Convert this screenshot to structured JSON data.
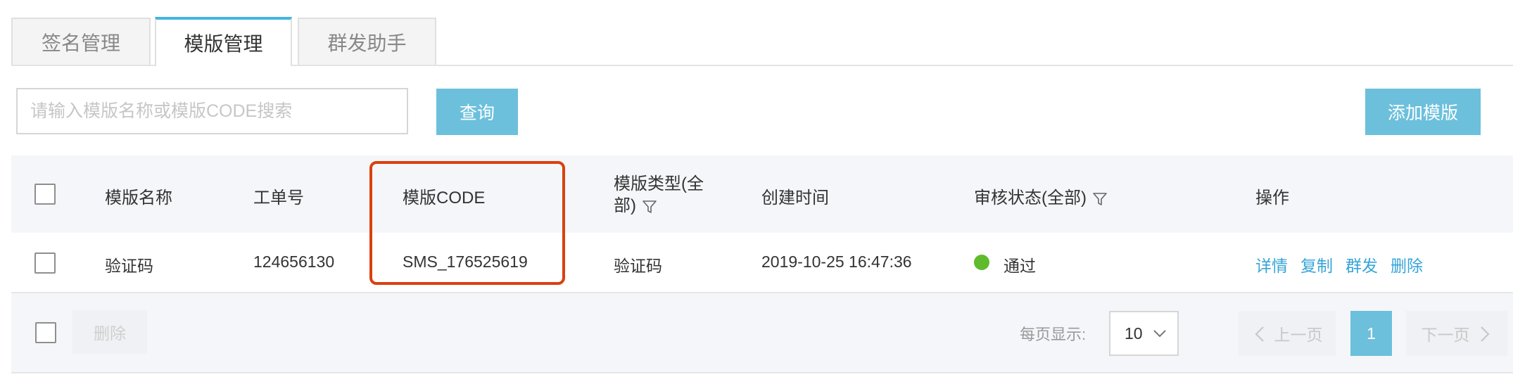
{
  "tabs": [
    {
      "label": "签名管理",
      "active": false
    },
    {
      "label": "模版管理",
      "active": true
    },
    {
      "label": "群发助手",
      "active": false
    }
  ],
  "search": {
    "placeholder": "请输入模版名称或模版CODE搜索",
    "value": "",
    "button_label": "查询"
  },
  "add_button_label": "添加模版",
  "table": {
    "headers": {
      "name": "模版名称",
      "ticket": "工单号",
      "code": "模版CODE",
      "type_line1": "模版类型(全",
      "type_line2": "部)",
      "created": "创建时间",
      "status": "审核状态(全部)",
      "actions": "操作"
    },
    "rows": [
      {
        "name": "验证码",
        "ticket": "124656130",
        "code": "SMS_176525619",
        "type": "验证码",
        "created": "2019-10-25 16:47:36",
        "status": "通过",
        "actions": [
          "详情",
          "复制",
          "群发",
          "删除"
        ]
      }
    ]
  },
  "footer": {
    "delete_label": "删除",
    "page_size_label": "每页显示:",
    "page_size_value": "10",
    "prev_label": "上一页",
    "current_page": "1",
    "next_label": "下一页"
  },
  "colors": {
    "accent": "#6cc0dc",
    "link": "#37a4d8",
    "status_ok": "#5dbb2c",
    "highlight": "#d9410f"
  },
  "icons": {
    "filter": "filter-icon",
    "chevron_down": "chevron-down-icon",
    "chevron_left": "chevron-left-icon",
    "chevron_right": "chevron-right-icon"
  }
}
